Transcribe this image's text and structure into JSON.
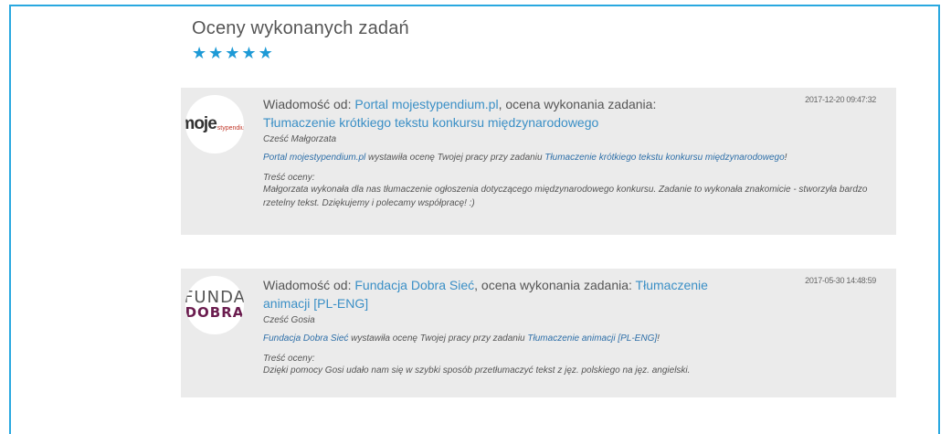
{
  "section": {
    "title": "Oceny wykonanych zadań",
    "rating_stars": 5,
    "star_glyph": "★",
    "star_color": "#1e9ad6"
  },
  "reviews": [
    {
      "logo": {
        "text_main": "moje",
        "text_small": "stypendium"
      },
      "head_prefix": "Wiadomość od: ",
      "sender": "Portal mojestypendium.pl",
      "head_middle": ", ocena wykonania zadania:",
      "task": "Tłumaczenie krótkiego tekstu konkursu międzynarodowego",
      "timestamp": "2017-12-20 09:47:32",
      "greeting": "Cześć Małgorzata",
      "notice_middle": " wystawiła ocenę Twojej pracy przy zadaniu ",
      "notice_suffix": "!",
      "review_label": "Treść oceny:",
      "review_text": "Małgorzata wykonała dla nas tłumaczenie ogłoszenia dotyczącego międzynarodowego konkursu. Zadanie to wykonała znakomicie - stworzyła bardzo rzetelny tekst. Dziękujemy i polecamy współpracę! :)"
    },
    {
      "logo": {
        "line1": "FUNDA",
        "line2": "DOBRA"
      },
      "head_prefix": "Wiadomość od: ",
      "sender": "Fundacja Dobra Sieć",
      "head_middle": ", ocena wykonania zadania: ",
      "task": "Tłumaczenie animacji [PL-ENG]",
      "timestamp": "2017-05-30 14:48:59",
      "greeting": "Cześć Gosia",
      "notice_middle": " wystawiła ocenę Twojej pracy przy zadaniu ",
      "notice_suffix": "!",
      "review_label": "Treść oceny:",
      "review_text": "Dzięki pomocy Gosi udało nam się w szybki sposób przetłumaczyć tekst z jęz. polskiego na jęz. angielski."
    }
  ]
}
